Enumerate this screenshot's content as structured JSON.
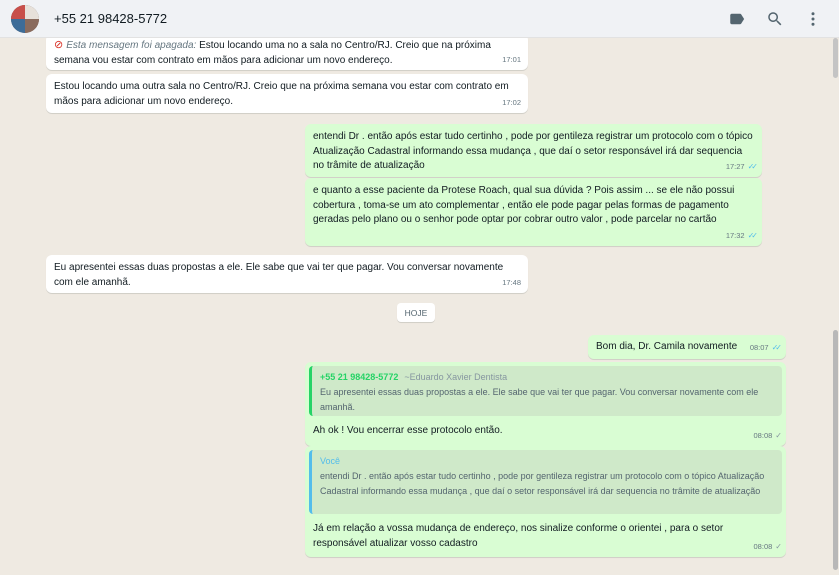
{
  "header": {
    "contact_name": "+55 21 98428-5772",
    "icons": [
      "label-icon",
      "search-icon",
      "menu-icon"
    ]
  },
  "messages": [
    {
      "direction": "in",
      "deleted_label": "Esta mensagem foi apagada:",
      "text_rest": "Estou locando uma no a sala no Centro/RJ. Creio que na próxima semana vou estar com contrato em mãos para adicionar um novo endereço.",
      "time": "17:01"
    },
    {
      "direction": "in",
      "text": "Estou locando uma outra sala no Centro/RJ. Creio que na próxima semana vou estar com contrato em mãos para adicionar um novo endereço.",
      "time": "17:02"
    },
    {
      "direction": "out",
      "text": "entendi Dr . então após estar tudo certinho , pode por gentileza registrar um protocolo com o tópico Atualização Cadastral informando essa mudança , que daí o setor responsável irá dar sequencia no trâmite de atualização",
      "time": "17:27",
      "status": "read"
    },
    {
      "direction": "out",
      "text": "e quanto a esse paciente da Protese Roach, qual sua dúvida ? Pois assim ... se ele não possui cobertura , toma-se um ato complementar , então ele pode pagar pelas formas de pagamento geradas pelo plano ou o senhor pode optar por cobrar outro valor , pode parcelar no cartão",
      "time": "17:32",
      "status": "read"
    },
    {
      "direction": "in",
      "text": "Eu apresentei essas duas propostas a ele. Ele sabe que vai ter que pagar. Vou conversar novamente com ele amanhã.",
      "time": "17:48"
    },
    {
      "direction": "out",
      "text": "Bom dia, Dr. Camila novamente",
      "time": "08:07",
      "status": "read"
    },
    {
      "direction": "out",
      "quote": {
        "author": "+55 21 98428-5772",
        "pushname": "~Eduardo Xavier Dentista",
        "text": "Eu apresentei essas duas propostas a ele. Ele sabe que vai ter que pagar. Vou conversar novamente com ele amanhã."
      },
      "text": "Ah ok ! Vou encerrar esse protocolo então.",
      "time": "08:08",
      "status": "delivered"
    },
    {
      "direction": "out",
      "quote": {
        "author": "Você",
        "text": "entendi Dr . então após estar tudo certinho , pode por gentileza registrar um protocolo com o tópico Atualização Cadastral informando essa mudança , que daí o setor responsável irá dar sequencia no trâmite de atualização"
      },
      "text": "Já em relação a vossa mudança de endereço, nos sinalize conforme o orientei , para o setor responsável atualizar vosso cadastro",
      "time": "08:08",
      "status": "delivered"
    }
  ],
  "date_divider": "HOJE",
  "colors": {
    "incoming": "#ffffff",
    "outgoing": "#d9fdd3",
    "wallpaper": "#efeae2",
    "read_ticks": "#53bdeb"
  }
}
